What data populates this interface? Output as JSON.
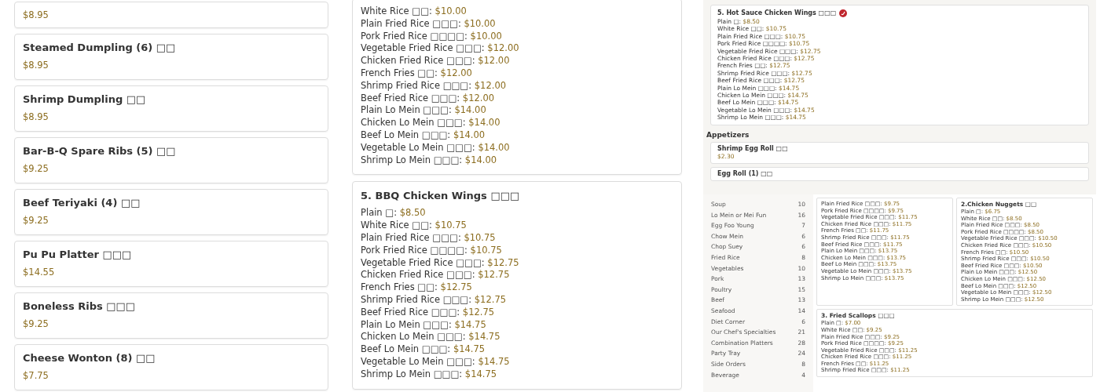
{
  "left_panel": {
    "items": [
      {
        "price": "$8.95"
      },
      {
        "name": "Steamed Dumpling (6) □□",
        "price": "$8.95"
      },
      {
        "name": "Shrimp Dumpling □□",
        "price": "$8.95"
      },
      {
        "name": "Bar-B-Q Spare Ribs (5) □□",
        "price": "$9.25"
      },
      {
        "name": "Beef Teriyaki (4) □□",
        "price": "$9.25"
      },
      {
        "name": "Pu Pu Platter □□□",
        "price": "$14.55"
      },
      {
        "name": "Boneless Ribs □□□",
        "price": "$9.25"
      },
      {
        "name": "Cheese Wonton (8) □□",
        "price": "$7.75"
      }
    ]
  },
  "middle_panel": {
    "cards": [
      {
        "options": [
          {
            "label": "White Rice □□:",
            "price": "$10.00"
          },
          {
            "label": "Plain Fried Rice □□□:",
            "price": "$10.00"
          },
          {
            "label": "Pork Fried Rice □□□□:",
            "price": "$10.00"
          },
          {
            "label": "Vegetable Fried Rice □□□:",
            "price": "$12.00"
          },
          {
            "label": "Chicken Fried Rice □□□:",
            "price": "$12.00"
          },
          {
            "label": "French Fries □□:",
            "price": "$12.00"
          },
          {
            "label": "Shrimp Fried Rice □□□:",
            "price": "$12.00"
          },
          {
            "label": "Beef Fried Rice □□□:",
            "price": "$12.00"
          },
          {
            "label": "Plain Lo Mein □□□:",
            "price": "$14.00"
          },
          {
            "label": "Chicken Lo Mein □□□:",
            "price": "$14.00"
          },
          {
            "label": "Beef Lo Mein □□□:",
            "price": "$14.00"
          },
          {
            "label": "Vegetable Lo Mein □□□:",
            "price": "$14.00"
          },
          {
            "label": "Shrimp Lo Mein □□□:",
            "price": "$14.00"
          }
        ]
      },
      {
        "title": "5. BBQ Chicken Wings □□□",
        "spicy": false,
        "options": [
          {
            "label": "Plain □:",
            "price": "$8.50"
          },
          {
            "label": "White Rice □□:",
            "price": "$10.75"
          },
          {
            "label": "Plain Fried Rice □□□:",
            "price": "$10.75"
          },
          {
            "label": "Pork Fried Rice □□□□:",
            "price": "$10.75"
          },
          {
            "label": "Vegetable Fried Rice □□□:",
            "price": "$12.75"
          },
          {
            "label": "Chicken Fried Rice □□□:",
            "price": "$12.75"
          },
          {
            "label": "French Fries □□:",
            "price": "$12.75"
          },
          {
            "label": "Shrimp Fried Rice □□□:",
            "price": "$12.75"
          },
          {
            "label": "Beef Fried Rice □□□:",
            "price": "$12.75"
          },
          {
            "label": "Plain Lo Mein □□□:",
            "price": "$14.75"
          },
          {
            "label": "Chicken Lo Mein □□□:",
            "price": "$14.75"
          },
          {
            "label": "Beef Lo Mein □□□:",
            "price": "$14.75"
          },
          {
            "label": "Vegetable Lo Mein □□□:",
            "price": "$14.75"
          },
          {
            "label": "Shrimp Lo Mein □□□:",
            "price": "$14.75"
          }
        ]
      }
    ]
  },
  "right_panel": {
    "card": {
      "title": "5. Hot Sauce Chicken Wings □□□",
      "spicy": true,
      "options": [
        {
          "label": "Plain □:",
          "price": "$8.50"
        },
        {
          "label": "White Rice □□:",
          "price": "$10.75"
        },
        {
          "label": "Plain Fried Rice □□□:",
          "price": "$10.75"
        },
        {
          "label": "Pork Fried Rice □□□□:",
          "price": "$10.75"
        },
        {
          "label": "Vegetable Fried Rice □□□:",
          "price": "$12.75"
        },
        {
          "label": "Chicken Fried Rice □□□:",
          "price": "$12.75"
        },
        {
          "label": "French Fries □□:",
          "price": "$12.75"
        },
        {
          "label": "Shrimp Fried Rice □□□:",
          "price": "$12.75"
        },
        {
          "label": "Beef Fried Rice □□□:",
          "price": "$12.75"
        },
        {
          "label": "Plain Lo Mein □□□:",
          "price": "$14.75"
        },
        {
          "label": "Chicken Lo Mein □□□:",
          "price": "$14.75"
        },
        {
          "label": "Beef Lo Mein □□□:",
          "price": "$14.75"
        },
        {
          "label": "Vegetable Lo Mein □□□:",
          "price": "$14.75"
        },
        {
          "label": "Shrimp Lo Mein □□□:",
          "price": "$14.75"
        }
      ]
    },
    "section_title": "Appetizers",
    "appetizers": [
      {
        "name": "Shrimp Egg Roll □□",
        "price": "$2.30"
      },
      {
        "name": "Egg Roll (1) □□"
      }
    ]
  },
  "overlay": {
    "categories": [
      {
        "name": "Soup",
        "count": "10"
      },
      {
        "name": "Lo Mein or Mei Fun",
        "count": "16"
      },
      {
        "name": "Egg Foo Young",
        "count": "7"
      },
      {
        "name": "Chow Mein",
        "count": "6"
      },
      {
        "name": "Chop Suey",
        "count": "6"
      },
      {
        "name": "Fried Rice",
        "count": "8"
      },
      {
        "name": "Vegetables",
        "count": "10"
      },
      {
        "name": "Pork",
        "count": "13"
      },
      {
        "name": "Poultry",
        "count": "15"
      },
      {
        "name": "Beef",
        "count": "13"
      },
      {
        "name": "Seafood",
        "count": "14"
      },
      {
        "name": "Diet Corner",
        "count": "6"
      },
      {
        "name": "Our Chef's Specialties",
        "count": "21"
      },
      {
        "name": "Combination Platters",
        "count": "28"
      },
      {
        "name": "Party Tray",
        "count": "24"
      },
      {
        "name": "Side Orders",
        "count": "8"
      },
      {
        "name": "Beverage",
        "count": "4"
      }
    ],
    "cards": [
      {
        "options": [
          {
            "label": "Plain Fried Rice □□□:",
            "price": "$9.75"
          },
          {
            "label": "Pork Fried Rice □□□□:",
            "price": "$9.75"
          },
          {
            "label": "Vegetable Fried Rice □□□:",
            "price": "$11.75"
          },
          {
            "label": "Chicken Fried Rice □□□:",
            "price": "$11.75"
          },
          {
            "label": "French Fries □□:",
            "price": "$11.75"
          },
          {
            "label": "Shrimp Fried Rice □□□:",
            "price": "$11.75"
          },
          {
            "label": "Beef Fried Rice □□□:",
            "price": "$11.75"
          },
          {
            "label": "Plain Lo Mein □□□:",
            "price": "$13.75"
          },
          {
            "label": "Chicken Lo Mein □□□:",
            "price": "$13.75"
          },
          {
            "label": "Beef Lo Mein □□□:",
            "price": "$13.75"
          },
          {
            "label": "Vegetable Lo Mein □□□:",
            "price": "$13.75"
          },
          {
            "label": "Shrimp Lo Mein □□□:",
            "price": "$13.75"
          }
        ]
      },
      {
        "title": "2.Chicken Nuggets □□",
        "options": [
          {
            "label": "Plain □:",
            "price": "$6.75"
          },
          {
            "label": "White Rice □□:",
            "price": "$8.50"
          },
          {
            "label": "Plain Fried Rice □□□:",
            "price": "$8.50"
          },
          {
            "label": "Pork Fried Rice □□□□:",
            "price": "$8.50"
          },
          {
            "label": "Vegetable Fried Rice □□□:",
            "price": "$10.50"
          },
          {
            "label": "Chicken Fried Rice □□□:",
            "price": "$10.50"
          },
          {
            "label": "French Fries □□:",
            "price": "$10.50"
          },
          {
            "label": "Shrimp Fried Rice □□□:",
            "price": "$10.50"
          },
          {
            "label": "Beef Fried Rice □□□:",
            "price": "$10.50"
          },
          {
            "label": "Plain Lo Mein □□□:",
            "price": "$12.50"
          },
          {
            "label": "Chicken Lo Mein □□□:",
            "price": "$12.50"
          },
          {
            "label": "Beef Lo Mein □□□:",
            "price": "$12.50"
          },
          {
            "label": "Vegetable Lo Mein □□□:",
            "price": "$12.50"
          },
          {
            "label": "Shrimp Lo Mein □□□:",
            "price": "$12.50"
          }
        ]
      },
      {
        "title": "3. Fried Scallops □□□",
        "options": [
          {
            "label": "Plain □:",
            "price": "$7.00"
          },
          {
            "label": "White Rice □□:",
            "price": "$9.25"
          },
          {
            "label": "Plain Fried Rice □□□:",
            "price": "$9.25"
          },
          {
            "label": "Pork Fried Rice □□□□:",
            "price": "$9.25"
          },
          {
            "label": "Vegetable Fried Rice □□□:",
            "price": "$11.25"
          },
          {
            "label": "Chicken Fried Rice □□□:",
            "price": "$11.25"
          },
          {
            "label": "French Fries □□:",
            "price": "$11.25"
          },
          {
            "label": "Shrimp Fried Rice □□□:",
            "price": "$11.25"
          }
        ]
      }
    ]
  }
}
